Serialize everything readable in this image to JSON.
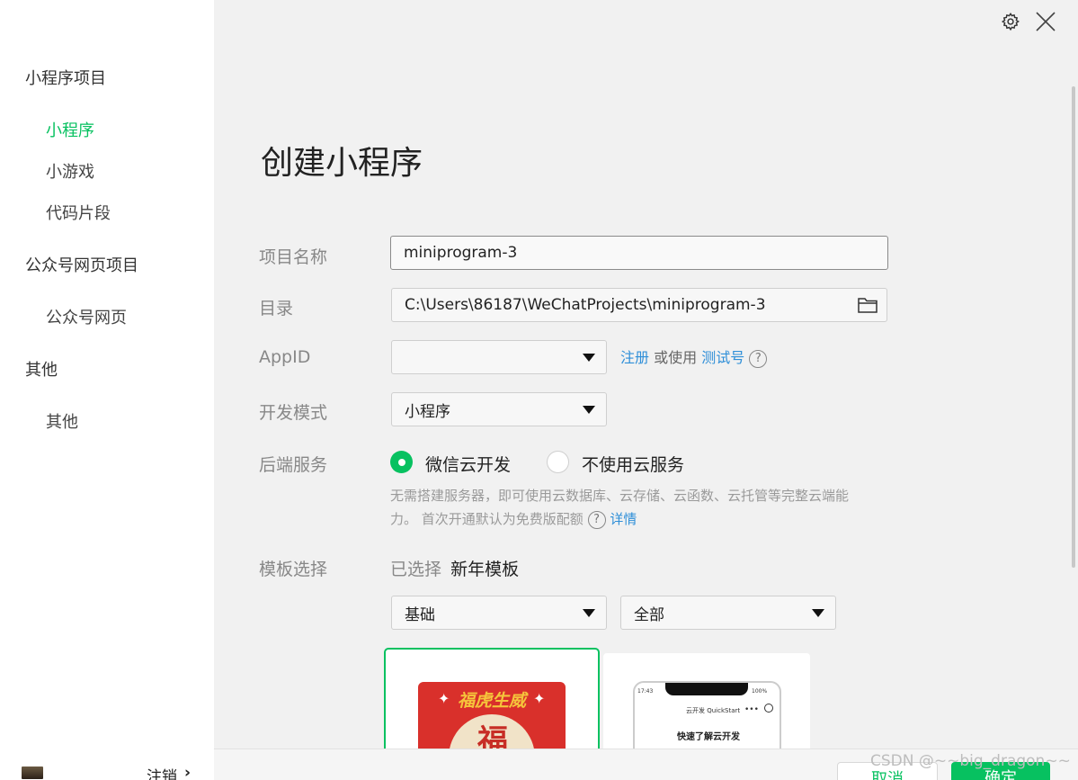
{
  "sidebar": {
    "groups": [
      {
        "title": "小程序项目",
        "items": [
          "小程序",
          "小游戏",
          "代码片段"
        ]
      },
      {
        "title": "公众号网页项目",
        "items": [
          "公众号网页"
        ]
      },
      {
        "title": "其他",
        "items": [
          "其他"
        ]
      }
    ],
    "active_item": "小程序",
    "logout_label": "注销",
    "logout_chevron": "›"
  },
  "header": {
    "icons": [
      "gear-icon",
      "close-icon"
    ]
  },
  "form": {
    "title": "创建小程序",
    "project_name": {
      "label": "项目名称",
      "value": "miniprogram-3"
    },
    "directory": {
      "label": "目录",
      "value": "C:\\Users\\86187\\WeChatProjects\\miniprogram-3"
    },
    "appid": {
      "label": "AppID",
      "value": "",
      "register_link": "注册",
      "or_use": "或使用",
      "test_link": "测试号"
    },
    "dev_mode": {
      "label": "开发模式",
      "value": "小程序"
    },
    "backend": {
      "label": "后端服务",
      "options": [
        "微信云开发",
        "不使用云服务"
      ],
      "selected": "微信云开发",
      "desc_line1": "无需搭建服务器，即可使用云数据库、云存储、云函数、云托管等完整云端能",
      "desc_line2": "力。 首次开通默认为免费版配额",
      "details_link": "详情"
    },
    "template": {
      "label": "模板选择",
      "selected_prefix": "已选择",
      "selected_name": "新年模板",
      "category_value": "基础",
      "filter_value": "全部",
      "card1_banner": "福虎生威",
      "card1_glyph": "福",
      "card2_time": "17:43",
      "card2_battery": "100%",
      "card2_title": "云开发 QuickStart",
      "card2_heading": "快速了解云开发"
    }
  },
  "footer": {
    "cancel_label": "取消",
    "ok_label": "确定",
    "watermark": "CSDN @~~big_dragon~~"
  },
  "colors": {
    "accent": "#07c160",
    "link": "#2f8fd8",
    "red": "#d9302b"
  }
}
